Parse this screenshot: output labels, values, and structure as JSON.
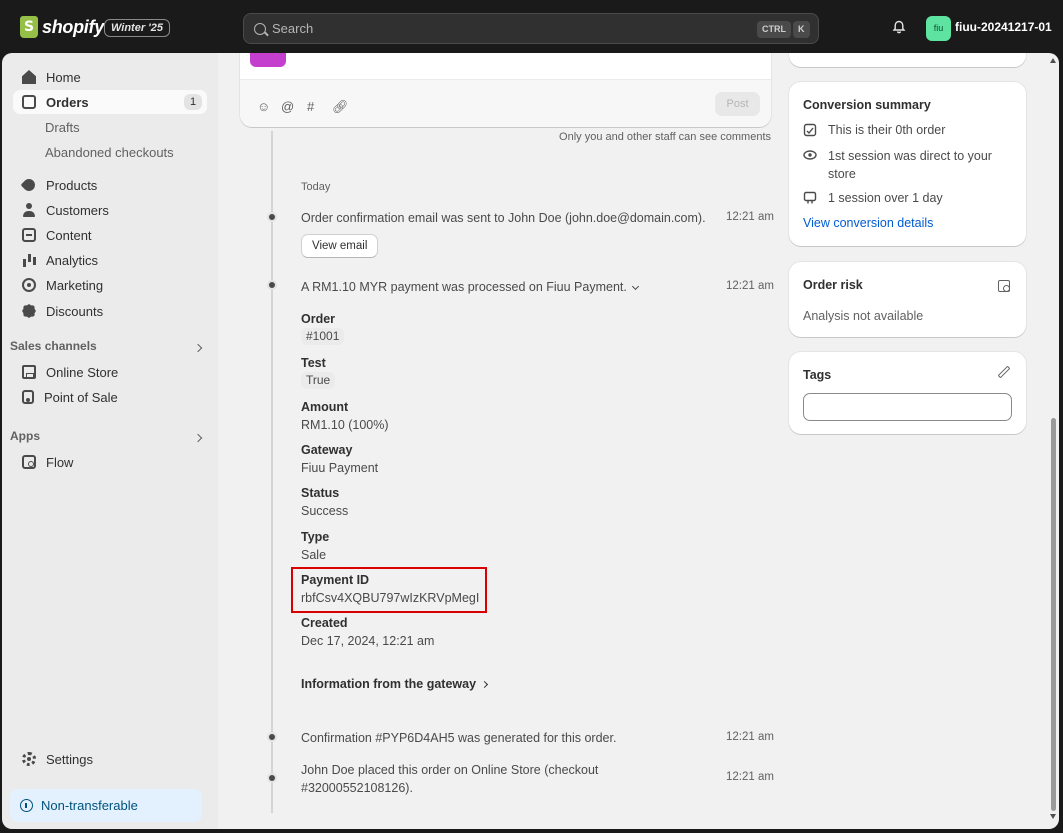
{
  "topbar": {
    "brand": "shopify",
    "edition_badge": "Winter '25",
    "search_placeholder": "Search",
    "shortcut_ctrl": "CTRL",
    "shortcut_k": "K",
    "store_avatar": "fiu",
    "store_name": "fiuu-20241217-01"
  },
  "sidebar": {
    "home": "Home",
    "orders": "Orders",
    "orders_count": "1",
    "drafts": "Drafts",
    "abandoned": "Abandoned checkouts",
    "products": "Products",
    "customers": "Customers",
    "content": "Content",
    "analytics": "Analytics",
    "marketing": "Marketing",
    "discounts": "Discounts",
    "sales_channels": "Sales channels",
    "online_store": "Online Store",
    "point_of_sale": "Point of Sale",
    "apps": "Apps",
    "flow": "Flow",
    "settings": "Settings",
    "non_transferable": "Non-transferable"
  },
  "comment": {
    "post": "Post",
    "staff_note": "Only you and other staff can see comments",
    "icons": [
      "emoji-icon",
      "mention-icon",
      "hashtag-icon",
      "attach-icon"
    ]
  },
  "timeline": {
    "today": "Today",
    "email_event": "Order confirmation email was sent to John Doe (john.doe@domain.com).",
    "email_time": "12:21 am",
    "view_email": "View email",
    "payment_event": "A RM1.10 MYR payment was processed on Fiuu Payment.",
    "payment_time": "12:21 am",
    "details": {
      "order_label": "Order",
      "order_value": "#1001",
      "test_label": "Test",
      "test_value": "True",
      "amount_label": "Amount",
      "amount_value": "RM1.10 (100%)",
      "gateway_label": "Gateway",
      "gateway_value": "Fiuu Payment",
      "status_label": "Status",
      "status_value": "Success",
      "type_label": "Type",
      "type_value": "Sale",
      "payment_id_label": "Payment ID",
      "payment_id_value": "rbfCsv4XQBU797wIzKRVpMegI",
      "created_label": "Created",
      "created_value": "Dec 17, 2024, 12:21 am"
    },
    "gateway_info": "Information from the gateway",
    "confirmation_event": "Confirmation #PYP6D4AH5 was generated for this order.",
    "confirmation_time": "12:21 am",
    "placed_event_line1": "John Doe placed this order on Online Store (checkout",
    "placed_event_line2": "#32000552108126).",
    "placed_time": "12:21 am"
  },
  "conversion": {
    "title": "Conversion summary",
    "row1": "This is their 0th order",
    "row2_line1": "1st session was direct to your",
    "row2_line2": "store",
    "row3": "1 session over 1 day",
    "link": "View conversion details"
  },
  "risk": {
    "title": "Order risk",
    "text": "Analysis not available"
  },
  "tags": {
    "title": "Tags",
    "input_value": ""
  }
}
